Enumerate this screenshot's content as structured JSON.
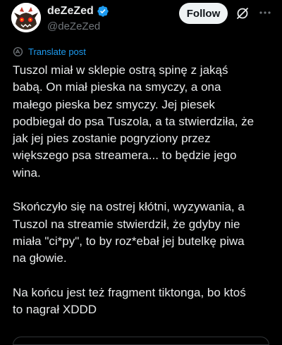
{
  "author": {
    "display_name": "deZeZed",
    "handle": "@deZeZed",
    "avatar_icon": "red-eyed-creature-avatar-icon",
    "verified_icon": "verified-badge-icon",
    "verified_color": "#1d9bf0"
  },
  "header": {
    "follow_label": "Follow",
    "grok_icon": "grok-icon",
    "more_icon": "more-dots-icon"
  },
  "translate": {
    "icon": "translate-globe-icon",
    "label": "Translate post",
    "color": "#1d9bf0"
  },
  "post": {
    "paragraphs": [
      "Tuszol miał w sklepie ostrą spinę z jakąś\nbabą. On miał pieska na smyczy, a ona\nmałego pieska bez smyczy. Jej piesek\npodbiegał do psa Tuszola, a ta stwierdziła, że\njak jej pies zostanie pogryziony przez\nwiększego psa streamera... to będzie jego\nwina.",
      "Skończyło się na ostrej kłótni, wyzywania, a\nTuszol na streamie stwierdził, że gdyby nie\nmiała \"ci*py\", to by roz*ebał jej butelkę piwa\nna głowie.",
      "Na końcu jest też fragment tiktonga, bo ktoś\nto nagrał XDDD"
    ]
  },
  "colors": {
    "background": "#000000",
    "text": "#e7e9ea",
    "secondary_text": "#71767b",
    "follow_bg": "#eff3f4",
    "accent": "#1d9bf0"
  }
}
